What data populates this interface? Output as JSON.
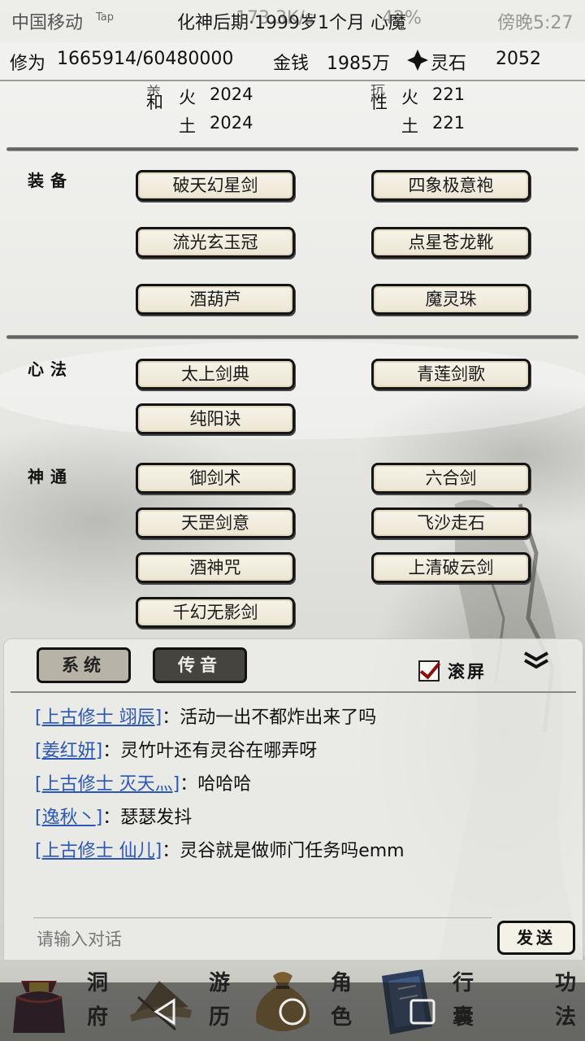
{
  "status_bar": {
    "carrier": "中国移动",
    "tap_label": "Tap",
    "title": "化神后期·1999岁1个月 心魔",
    "speed": "173.3K/s",
    "battery": "42%",
    "time": "傍晚5:27"
  },
  "resources": {
    "cultivation_label": "修为",
    "cultivation_value": "1665914/60480000",
    "money_label": "金钱",
    "money_value": "1985万",
    "spirit_stone_label": "灵石",
    "spirit_stone_value": "2052"
  },
  "attributes": {
    "left_label_line1": "亲",
    "left_label_line2": "和",
    "right_label_line1": "抗",
    "right_label_line2": "性",
    "rows": [
      {
        "left_elem": "火",
        "left_value": "2024",
        "right_elem": "火",
        "right_value": "221"
      },
      {
        "left_elem": "土",
        "left_value": "2024",
        "right_elem": "土",
        "right_value": "221"
      }
    ]
  },
  "equipment": {
    "label": "装备",
    "items": [
      "破天幻星剑",
      "四象极意袍",
      "流光玄玉冠",
      "点星苍龙靴",
      "酒葫芦",
      "魔灵珠"
    ]
  },
  "mind_methods": {
    "label": "心法",
    "items": [
      "太上剑典",
      "青莲剑歌",
      "纯阳诀"
    ]
  },
  "divine_arts": {
    "label": "神通",
    "items": [
      "御剑术",
      "六合剑",
      "天罡剑意",
      "飞沙走石",
      "酒神咒",
      "上清破云剑",
      "千幻无影剑"
    ]
  },
  "chat": {
    "tab_system": "系统",
    "tab_voice": "传音",
    "scroll_label": "滚屏",
    "collapse_icon": "double-chevron-down",
    "messages": [
      {
        "name": "上古修士 翊辰",
        "text": "：活动一出不都炸出来了吗"
      },
      {
        "name": "姜红妍",
        "text": "：灵竹叶还有灵谷在哪弄呀"
      },
      {
        "name": "上古修士 灭天灬",
        "text": "：哈哈哈"
      },
      {
        "name": "逸秋丶",
        "text": "：瑟瑟发抖"
      },
      {
        "name": "上古修士 仙儿",
        "text": "：灵谷就是做师门任务吗emm"
      }
    ],
    "input_placeholder": "请输入对话",
    "send_label": "发送"
  },
  "bottom_nav": [
    {
      "line1": "洞",
      "line2": "府",
      "icon": "treasure-bag-icon"
    },
    {
      "line1": "游",
      "line2": "历",
      "icon": "straw-hat-icon"
    },
    {
      "line1": "角",
      "line2": "色",
      "icon": "money-pouch-icon"
    },
    {
      "line1": "行",
      "line2": "囊",
      "icon": "book-icon"
    }
  ],
  "bottom_nav_extra": {
    "line1": "功",
    "line2": "法"
  },
  "colors": {
    "link": "#2b57b8",
    "check": "#8a1010",
    "button_bg": "#f6f3e8",
    "voice_tab_bg": "#46443f"
  }
}
